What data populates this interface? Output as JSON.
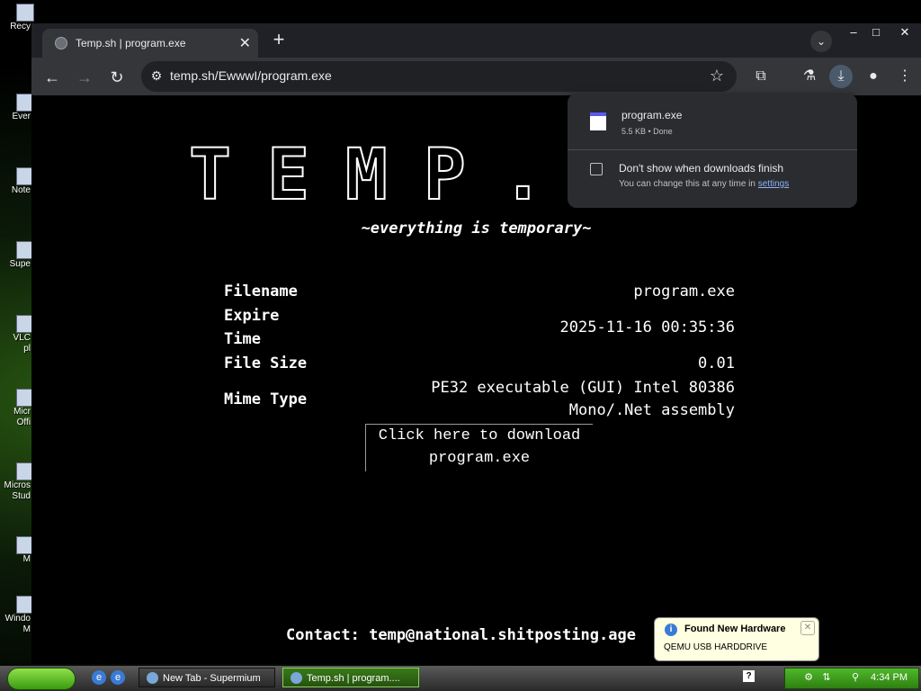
{
  "desktop": {
    "icons": [
      {
        "label": "Recy"
      },
      {
        "label": "Ever"
      },
      {
        "label": "Note"
      },
      {
        "label": "Supe"
      },
      {
        "label": "VLC"
      },
      {
        "label": "pl"
      },
      {
        "label": "Micr"
      },
      {
        "label": "Offi"
      },
      {
        "label": "Micros"
      },
      {
        "label": "Stud"
      },
      {
        "label": "M"
      },
      {
        "label": "Windo"
      },
      {
        "label": "M"
      }
    ]
  },
  "browser": {
    "tab_title": "Temp.sh | program.exe",
    "address": "temp.sh/EwwwI/program.exe"
  },
  "page": {
    "logo": "TEMP.SH",
    "tagline": "~everything is temporary~",
    "rows": {
      "filename_label": "Filename",
      "filename_value": "program.exe",
      "expire_label_1": "Expire",
      "expire_label_2": "Time",
      "expire_value": "2025-11-16 00:35:36",
      "size_label": "File Size",
      "size_value": "0.01",
      "mime_label": "Mime Type",
      "mime_value_1": "PE32 executable (GUI) Intel 80386",
      "mime_value_2": "Mono/.Net assembly"
    },
    "download_line_1": "Click here to download",
    "download_line_2": "program.exe",
    "contact": "Contact: temp@national.shitposting.age"
  },
  "downloads": {
    "file_name": "program.exe",
    "file_status": "5.5 KB • Done",
    "option": "Don't show when downloads finish",
    "hint_prefix": "You can change this at any time in ",
    "hint_link": "settings"
  },
  "balloon": {
    "title": "Found New Hardware",
    "message": "QEMU USB HARDDRIVE"
  },
  "taskbar": {
    "task1": "New Tab - Supermium",
    "task2": "Temp.sh | program....",
    "clock": "4:34 PM"
  }
}
